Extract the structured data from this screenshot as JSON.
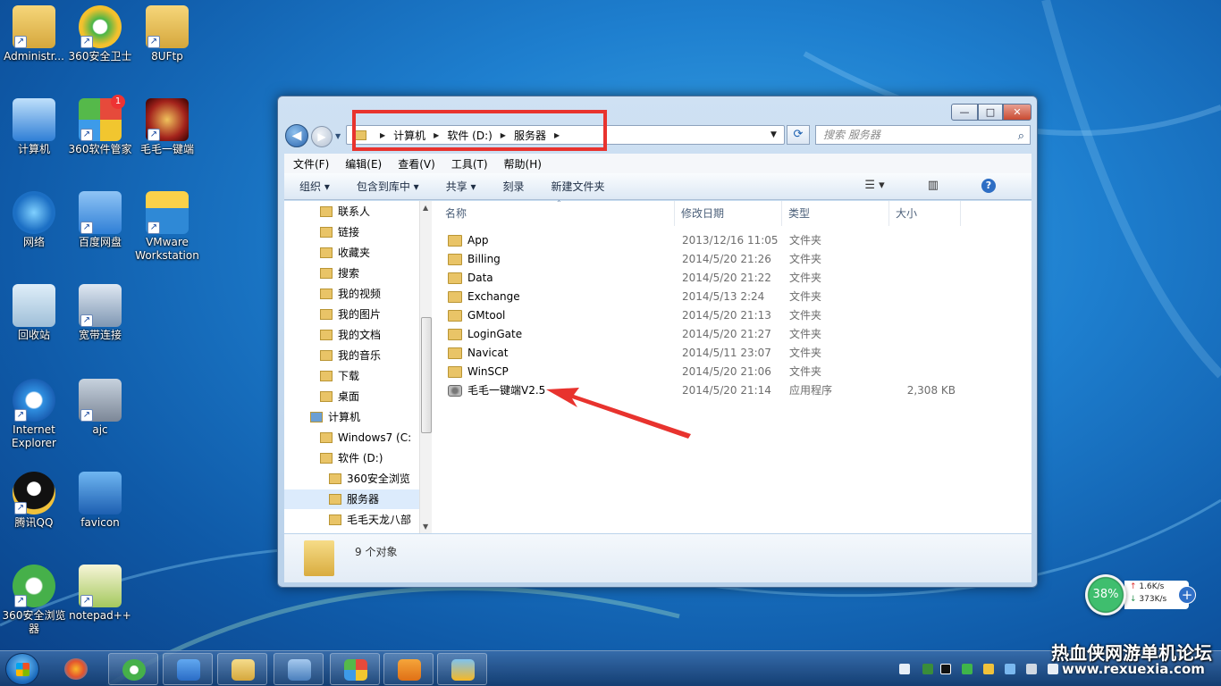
{
  "desktop": {
    "icons": [
      {
        "label": "Administr...",
        "icon": "user-folder-icon"
      },
      {
        "label": "360安全卫士",
        "icon": "360-safe-icon"
      },
      {
        "label": "8UFtp",
        "icon": "folder-icon"
      },
      {
        "label": "计算机",
        "icon": "computer-icon"
      },
      {
        "label": "360软件管家",
        "icon": "360-software-manager-icon",
        "badge": "1"
      },
      {
        "label": "毛毛一键端",
        "icon": "game-launcher-icon"
      },
      {
        "label": "网络",
        "icon": "network-icon"
      },
      {
        "label": "百度网盘",
        "icon": "baidu-netdisk-icon"
      },
      {
        "label": "VMware Workstation",
        "icon": "vmware-icon"
      },
      {
        "label": "回收站",
        "icon": "recycle-bin-icon"
      },
      {
        "label": "宽带连接",
        "icon": "broadband-connection-icon"
      },
      {
        "label": "Internet Explorer",
        "icon": "internet-explorer-icon"
      },
      {
        "label": "ajc",
        "icon": "jpeg-compressor-icon"
      },
      {
        "label": "腾讯QQ",
        "icon": "qq-icon"
      },
      {
        "label": "favicon",
        "icon": "favicon-icon"
      },
      {
        "label": "360安全浏览器",
        "icon": "360-browser-icon"
      },
      {
        "label": "notepad++",
        "icon": "notepad-plus-plus-icon"
      }
    ]
  },
  "window": {
    "breadcrumb": [
      "计算机",
      "软件 (D:)",
      "服务器"
    ],
    "search_placeholder": "搜索 服务器",
    "controls": {
      "min": "—",
      "max": "□",
      "close": "✕"
    },
    "menu": [
      "文件(F)",
      "编辑(E)",
      "查看(V)",
      "工具(T)",
      "帮助(H)"
    ],
    "toolbar": {
      "organize": "组织 ▾",
      "include": "包含到库中 ▾",
      "share": "共享 ▾",
      "burn": "刻录",
      "new_folder": "新建文件夹"
    },
    "nav_pane": [
      {
        "label": "联系人",
        "indent": 1
      },
      {
        "label": "链接",
        "indent": 1
      },
      {
        "label": "收藏夹",
        "indent": 1
      },
      {
        "label": "搜索",
        "indent": 1
      },
      {
        "label": "我的视频",
        "indent": 1
      },
      {
        "label": "我的图片",
        "indent": 1
      },
      {
        "label": "我的文档",
        "indent": 1
      },
      {
        "label": "我的音乐",
        "indent": 1
      },
      {
        "label": "下载",
        "indent": 1
      },
      {
        "label": "桌面",
        "indent": 1
      },
      {
        "label": "计算机",
        "indent": 0
      },
      {
        "label": "Windows7 (C:",
        "indent": 1
      },
      {
        "label": "软件 (D:)",
        "indent": 1
      },
      {
        "label": "360安全浏览",
        "indent": 2
      },
      {
        "label": "服务器",
        "indent": 2,
        "selected": true
      },
      {
        "label": "毛毛天龙八部",
        "indent": 2
      }
    ],
    "columns": {
      "name": "名称",
      "date": "修改日期",
      "type": "类型",
      "size": "大小"
    },
    "files": [
      {
        "name": "App",
        "date": "2013/12/16 11:05",
        "type": "文件夹",
        "size": ""
      },
      {
        "name": "Billing",
        "date": "2014/5/20 21:26",
        "type": "文件夹",
        "size": ""
      },
      {
        "name": "Data",
        "date": "2014/5/20 21:22",
        "type": "文件夹",
        "size": ""
      },
      {
        "name": "Exchange",
        "date": "2014/5/13 2:24",
        "type": "文件夹",
        "size": ""
      },
      {
        "name": "GMtool",
        "date": "2014/5/20 21:13",
        "type": "文件夹",
        "size": ""
      },
      {
        "name": "LoginGate",
        "date": "2014/5/20 21:27",
        "type": "文件夹",
        "size": ""
      },
      {
        "name": "Navicat",
        "date": "2014/5/11 23:07",
        "type": "文件夹",
        "size": ""
      },
      {
        "name": "WinSCP",
        "date": "2014/5/20 21:06",
        "type": "文件夹",
        "size": ""
      },
      {
        "name": "毛毛一键端V2.5",
        "date": "2014/5/20 21:14",
        "type": "应用程序",
        "size": "2,308 KB",
        "is_app": true
      }
    ],
    "status": "9 个对象"
  },
  "speed_widget": {
    "percent": "38%",
    "up": "1.6K/s",
    "down": "373K/s"
  },
  "watermark": {
    "main": "热血侠网游单机论坛",
    "sub": "www.rexuexia.com"
  },
  "colors": {
    "highlight": "#e8332e",
    "arrow": "#e8332e"
  }
}
